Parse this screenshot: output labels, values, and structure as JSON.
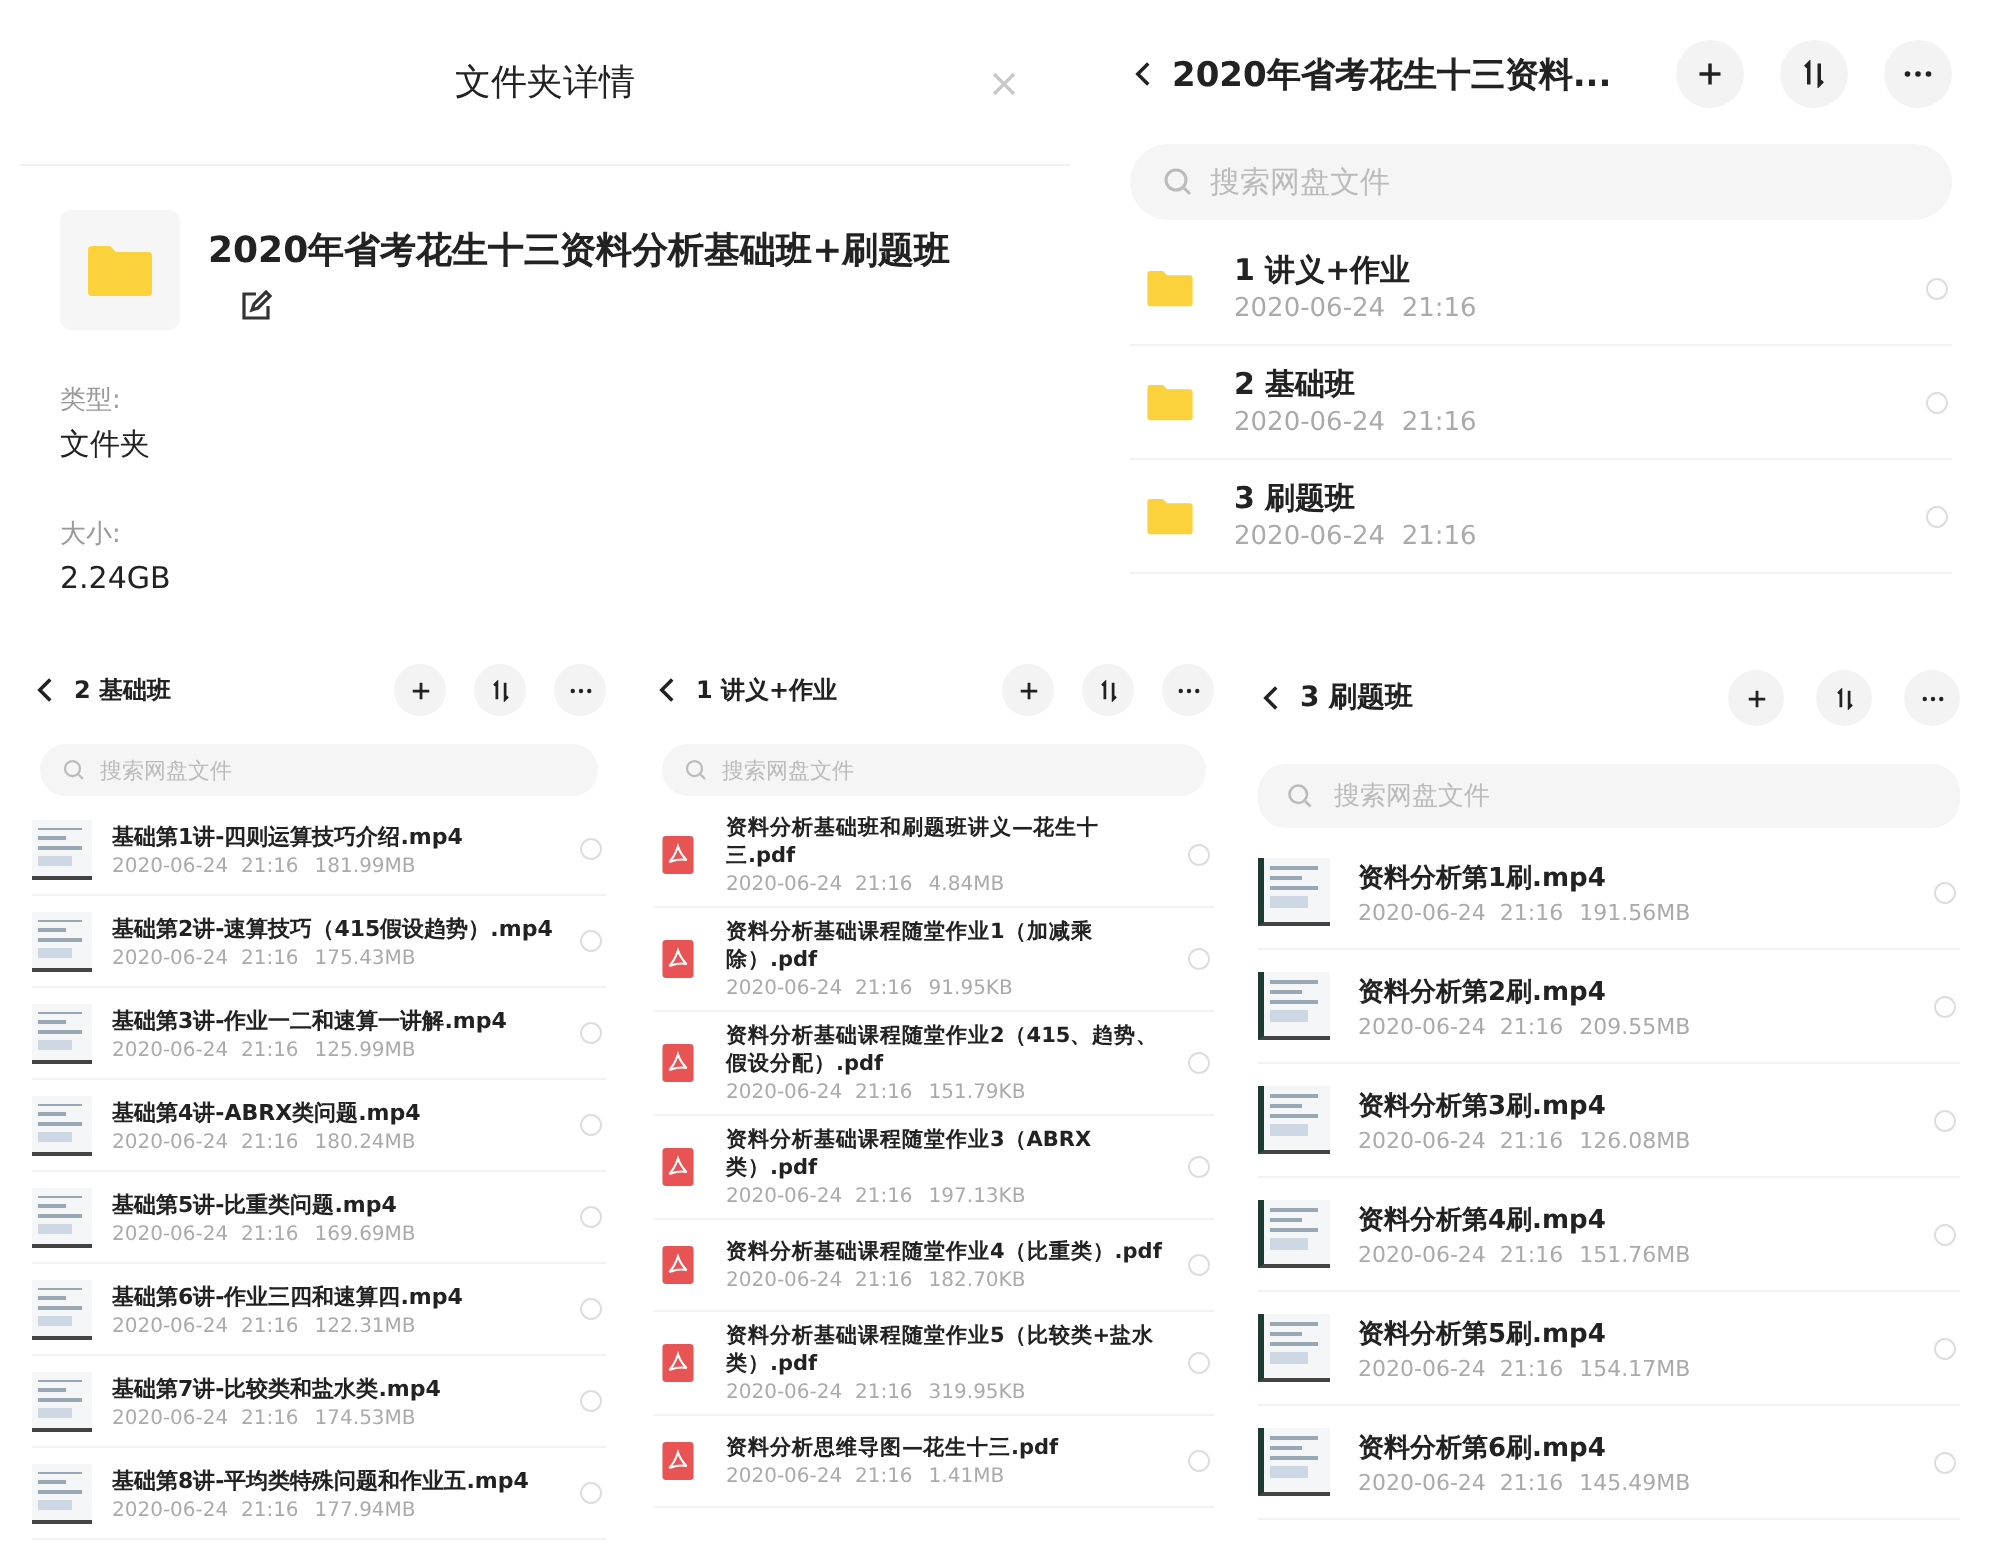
{
  "details": {
    "title": "文件夹详情",
    "name": "2020年省考花生十三资料分析基础班+刷题班",
    "fields": [
      {
        "label": "类型:",
        "value": "文件夹"
      },
      {
        "label": "大小:",
        "value": "2.24GB"
      }
    ]
  },
  "browsers": [
    {
      "title": "2020年省考花生十三资料...",
      "placeholder": "搜索网盘文件",
      "items": [
        {
          "kind": "folder",
          "name": "1 讲义+作业",
          "date": "2020-06-24  21:16",
          "selected": false
        },
        {
          "kind": "folder",
          "name": "2 基础班",
          "date": "2020-06-24  21:16",
          "selected": false
        },
        {
          "kind": "folder",
          "name": "3 刷题班",
          "date": "2020-06-24  21:16",
          "selected": false
        }
      ]
    },
    {
      "title": "2 基础班",
      "placeholder": "搜索网盘文件",
      "items": [
        {
          "kind": "video",
          "name": "基础第1讲-四则运算技巧介绍.mp4",
          "date": "2020-06-24  21:16",
          "size": "181.99MB",
          "selected": false
        },
        {
          "kind": "video",
          "name": "基础第2讲-速算技巧（415假设趋势）.mp4",
          "date": "2020-06-24  21:16",
          "size": "175.43MB",
          "selected": false
        },
        {
          "kind": "video",
          "name": "基础第3讲-作业一二和速算一讲解.mp4",
          "date": "2020-06-24  21:16",
          "size": "125.99MB",
          "selected": false
        },
        {
          "kind": "video",
          "name": "基础第4讲-ABRX类问题.mp4",
          "date": "2020-06-24  21:16",
          "size": "180.24MB",
          "selected": false
        },
        {
          "kind": "video",
          "name": "基础第5讲-比重类问题.mp4",
          "date": "2020-06-24  21:16",
          "size": "169.69MB",
          "selected": false
        },
        {
          "kind": "video",
          "name": "基础第6讲-作业三四和速算四.mp4",
          "date": "2020-06-24  21:16",
          "size": "122.31MB",
          "selected": false
        },
        {
          "kind": "video",
          "name": "基础第7讲-比较类和盐水类.mp4",
          "date": "2020-06-24  21:16",
          "size": "174.53MB",
          "selected": false
        },
        {
          "kind": "video",
          "name": "基础第8讲-平均类特殊问题和作业五.mp4",
          "date": "2020-06-24  21:16",
          "size": "177.94MB",
          "selected": false
        }
      ]
    },
    {
      "title": "1 讲义+作业",
      "placeholder": "搜索网盘文件",
      "items": [
        {
          "kind": "pdf",
          "name": "资料分析基础班和刷题班讲义—花生十三.pdf",
          "date": "2020-06-24  21:16",
          "size": "4.84MB",
          "selected": false
        },
        {
          "kind": "pdf",
          "name": "资料分析基础课程随堂作业1（加减乘除）.pdf",
          "date": "2020-06-24  21:16",
          "size": "91.95KB",
          "selected": false
        },
        {
          "kind": "pdf",
          "name": "资料分析基础课程随堂作业2（415、趋势、假设分配）.pdf",
          "date": "2020-06-24  21:16",
          "size": "151.79KB",
          "selected": false
        },
        {
          "kind": "pdf",
          "name": "资料分析基础课程随堂作业3（ABRX类）.pdf",
          "date": "2020-06-24  21:16",
          "size": "197.13KB",
          "selected": false
        },
        {
          "kind": "pdf",
          "name": "资料分析基础课程随堂作业4（比重类）.pdf",
          "date": "2020-06-24  21:16",
          "size": "182.70KB",
          "selected": false
        },
        {
          "kind": "pdf",
          "name": "资料分析基础课程随堂作业5（比较类+盐水类）.pdf",
          "date": "2020-06-24  21:16",
          "size": "319.95KB",
          "selected": false
        },
        {
          "kind": "pdf",
          "name": "资料分析思维导图—花生十三.pdf",
          "date": "2020-06-24  21:16",
          "size": "1.41MB",
          "selected": false
        }
      ]
    },
    {
      "title": "3 刷题班",
      "placeholder": "搜索网盘文件",
      "items": [
        {
          "kind": "video",
          "name": "资料分析第1刷.mp4",
          "date": "2020-06-24  21:16",
          "size": "191.56MB",
          "selected": false
        },
        {
          "kind": "video",
          "name": "资料分析第2刷.mp4",
          "date": "2020-06-24  21:16",
          "size": "209.55MB",
          "selected": false
        },
        {
          "kind": "video",
          "name": "资料分析第3刷.mp4",
          "date": "2020-06-24  21:16",
          "size": "126.08MB",
          "selected": false
        },
        {
          "kind": "video",
          "name": "资料分析第4刷.mp4",
          "date": "2020-06-24  21:16",
          "size": "151.76MB",
          "selected": false
        },
        {
          "kind": "video",
          "name": "资料分析第5刷.mp4",
          "date": "2020-06-24  21:16",
          "size": "154.17MB",
          "selected": false
        },
        {
          "kind": "video",
          "name": "资料分析第6刷.mp4",
          "date": "2020-06-24  21:16",
          "size": "145.49MB",
          "selected": false
        }
      ]
    }
  ]
}
